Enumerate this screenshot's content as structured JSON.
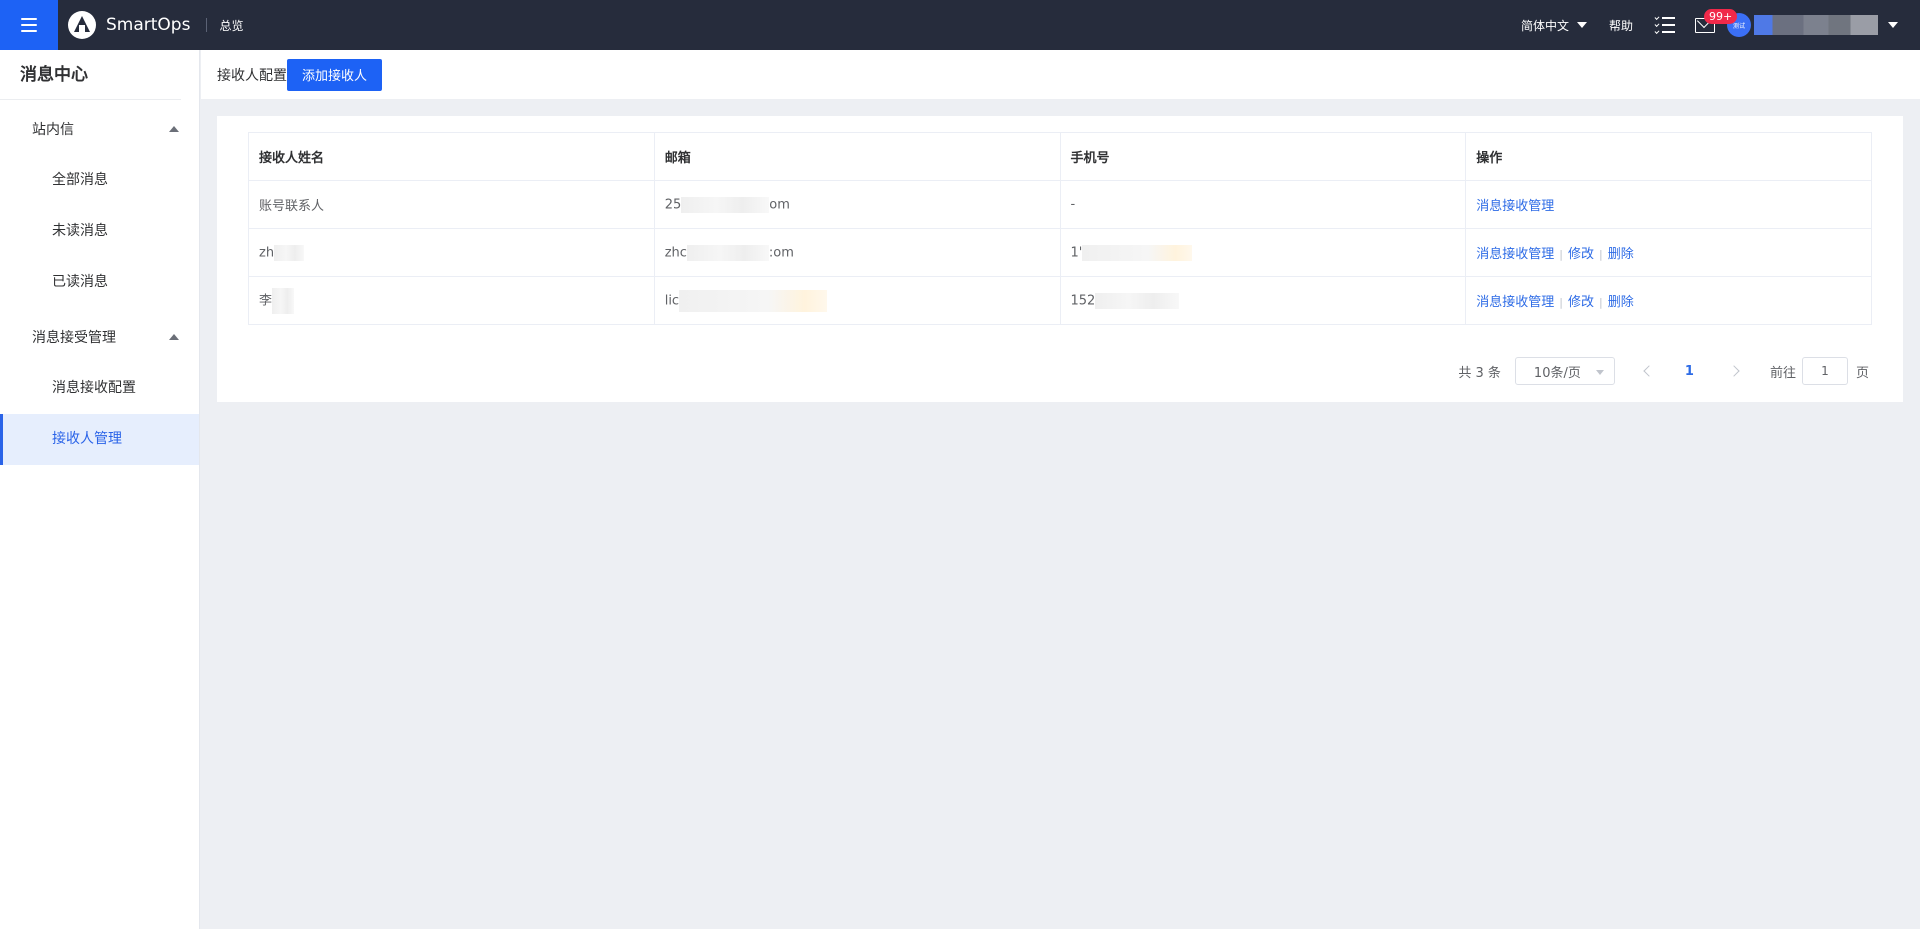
{
  "header": {
    "app_name": "SmartOps",
    "nav_overview": "总览",
    "language": "简体中文",
    "help": "帮助",
    "mail_badge": "99+",
    "avatar_text": "测试",
    "colors": {
      "topbar": "#262c3c",
      "accent": "#1d62f5",
      "badge": "#f0294a"
    },
    "icons": [
      "menu-icon",
      "logo-icon",
      "tasks-icon",
      "mail-icon"
    ]
  },
  "sidebar": {
    "title": "消息中心",
    "groups": [
      {
        "label": "站内信",
        "items": [
          "全部消息",
          "未读消息",
          "已读消息"
        ]
      },
      {
        "label": "消息接受管理",
        "items": [
          "消息接收配置",
          "接收人管理"
        ]
      }
    ],
    "active_item": "接收人管理"
  },
  "page": {
    "title": "接收人配置",
    "add_button": "添加接收人"
  },
  "table": {
    "headers": [
      "接收人姓名",
      "邮箱",
      "手机号",
      "操作"
    ],
    "rows": [
      {
        "name": "账号联系人",
        "email_prefix": "25",
        "email_suffix": "om",
        "phone_prefix": "-",
        "actions": [
          "消息接收管理"
        ]
      },
      {
        "name": "zh",
        "email_prefix": "zhc",
        "email_suffix": ":om",
        "phone_prefix": "1'",
        "actions": [
          "消息接收管理",
          "修改",
          "删除"
        ]
      },
      {
        "name": "李",
        "email_prefix": "lic",
        "email_suffix": "",
        "phone_prefix": "152",
        "actions": [
          "消息接收管理",
          "修改",
          "删除"
        ]
      }
    ],
    "action_separator": "|"
  },
  "pagination": {
    "total": "共 3 条",
    "page_size": "10条/页",
    "current_page": "1",
    "goto_label": "前往",
    "goto_value": "1",
    "page_unit": "页"
  }
}
